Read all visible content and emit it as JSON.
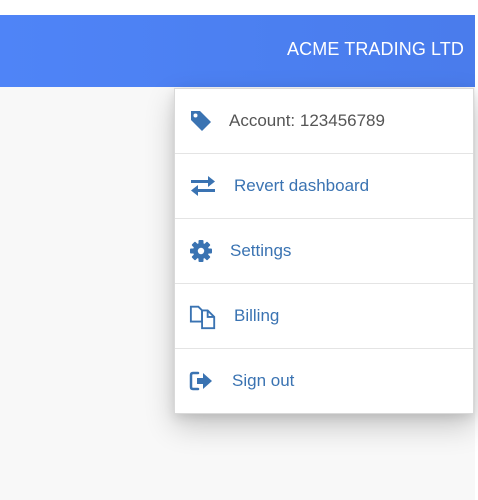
{
  "header": {
    "company_name": "ACME TRADING LTD"
  },
  "menu": {
    "items": [
      {
        "icon": "tag-icon",
        "label": "Account: 123456789"
      },
      {
        "icon": "exchange-arrows-icon",
        "label": "Revert dashboard"
      },
      {
        "icon": "gear-icon",
        "label": "Settings"
      },
      {
        "icon": "copy-documents-icon",
        "label": "Billing"
      },
      {
        "icon": "sign-out-icon",
        "label": "Sign out"
      }
    ]
  },
  "colors": {
    "header_bg": "#4f84f7",
    "link": "#3a73b2",
    "account_text": "#555555"
  }
}
